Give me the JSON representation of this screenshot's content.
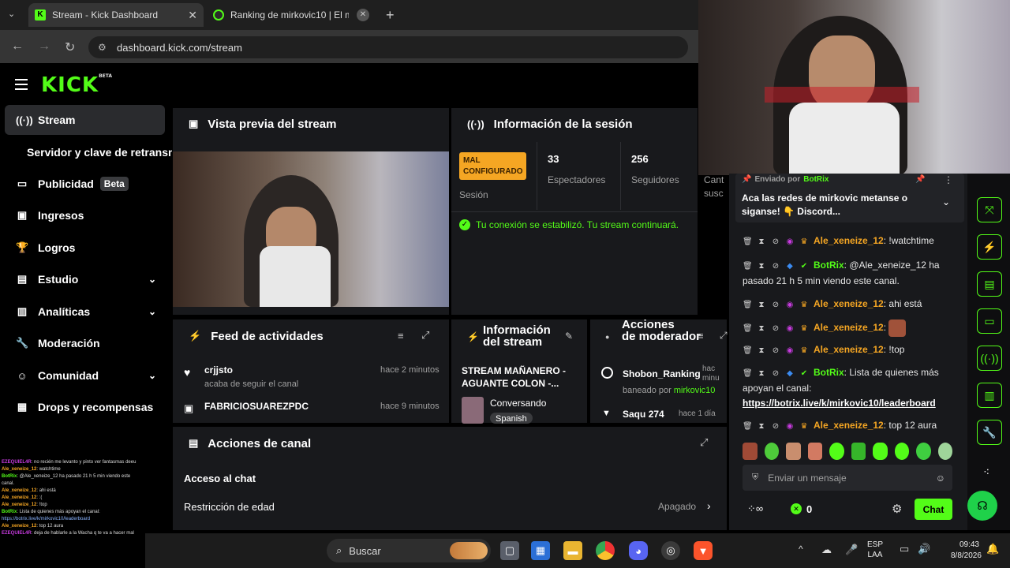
{
  "browser": {
    "tabs": [
      {
        "label": "Stream - Kick Dashboard",
        "close": "✕"
      },
      {
        "label": "Ranking de mirkovic10 | El mej",
        "close": "✕"
      }
    ],
    "new_tab": "+",
    "url": "dashboard.kick.com/stream"
  },
  "brand": {
    "logo": "KICK",
    "beta": "BETA",
    "accent": "#53fc18"
  },
  "sidebar": {
    "items": [
      {
        "label": "Stream",
        "icon": "broadcast-icon"
      },
      {
        "label": "Servidor y clave de retransn"
      },
      {
        "label": "Publicidad",
        "badge": "Beta",
        "icon": "ad-icon"
      },
      {
        "label": "Ingresos",
        "icon": "wallet-icon"
      },
      {
        "label": "Logros",
        "icon": "trophy-icon"
      },
      {
        "label": "Estudio",
        "icon": "studio-icon"
      },
      {
        "label": "Analíticas",
        "icon": "chart-icon"
      },
      {
        "label": "Moderación",
        "icon": "wrench-icon"
      },
      {
        "label": "Comunidad",
        "icon": "community-icon"
      },
      {
        "label": "Drops y recompensas",
        "icon": "gift-icon"
      }
    ]
  },
  "preview": {
    "title": "Vista previa del stream"
  },
  "session": {
    "title": "Información de la sesión",
    "status_badge": "MAL CONFIGURADO",
    "status_label": "Sesión",
    "viewers": "33",
    "viewers_label": "Espectadores",
    "followers": "256",
    "followers_label": "Seguidores",
    "extra_label": "Cant",
    "extra_label2": "susc",
    "connection": "Tu conexión se estabilizó. Tu stream continuará."
  },
  "feed": {
    "title": "Feed de actividades",
    "items": [
      {
        "user": "crjjsto",
        "action": "acaba de seguir el canal",
        "time": "hace 2 minutos"
      },
      {
        "user": "FABRICIOSUAREZPDC",
        "action": "",
        "time": "hace 9 minutos"
      }
    ]
  },
  "stream_info": {
    "title1": "Información",
    "title2": "del stream",
    "stream_title": "STREAM MAÑANERO - AGUANTE COLON -...",
    "category": "Conversando",
    "language": "Spanish"
  },
  "mod_actions": {
    "title1": "Acciones",
    "title2": "de moderador",
    "items": [
      {
        "user": "Shobon_Ranking",
        "detail": "baneado por",
        "by": "mirkovic10",
        "time": "hac minu"
      },
      {
        "user": "Saqu",
        "count": "274",
        "time": "hace 1 día"
      }
    ]
  },
  "channel_actions": {
    "title": "Acciones de canal",
    "chat_access": "Acceso al chat",
    "age_restriction": "Restricción de edad",
    "age_value": "Apagado"
  },
  "pinned": {
    "sent_by": "Enviado por",
    "bot": "BotRix",
    "text": "Aca las redes de mirkovic metanse o siganse! 👇 Discord..."
  },
  "chat": {
    "messages": [
      {
        "user": "Ale_xeneize_12",
        "text": "!watchtime",
        "kind": "user"
      },
      {
        "user": "BotRix",
        "text": "@Ale_xeneize_12 ha pasado 21 h 5 min viendo este canal.",
        "kind": "bot"
      },
      {
        "user": "Ale_xeneize_12",
        "text": "ahi está",
        "kind": "user"
      },
      {
        "user": "Ale_xeneize_12",
        "text": "",
        "kind": "emote"
      },
      {
        "user": "Ale_xeneize_12",
        "text": "!top",
        "kind": "user"
      },
      {
        "user": "BotRix",
        "text": "Lista de quienes más apoyan el canal:",
        "kind": "bot"
      },
      {
        "user": "Ale_xeneize_12",
        "text": "top 12 aura",
        "kind": "user"
      }
    ],
    "link": "https://botrix.live/k/mirkovic10/leaderboard",
    "placeholder": "Enviar un mensaje",
    "points": "0",
    "send_label": "Chat"
  },
  "overlay_chat": [
    {
      "user": "EZEQUIEL4R",
      "text": "no recién me levanto y pinto ver fantasmas deeu"
    },
    {
      "user": "Ale_xeneize_12",
      "text": "watchtime"
    },
    {
      "user": "BotRix",
      "text": "@Ale_xeneize_12 ha pasado 21 h 5 min viendo este canal."
    },
    {
      "user": "Ale_xeneize_12",
      "text": "ahi está"
    },
    {
      "user": "Ale_xeneize_12",
      "text": ":("
    },
    {
      "user": "Ale_xeneize_12",
      "text": "!top"
    },
    {
      "user": "BotRix",
      "text": "Lista de quienes más apoyan el canal:"
    },
    {
      "user": "",
      "text": "https://botrix.live/k/mirkovic10/leaderboard"
    },
    {
      "user": "Ale_xeneize_12",
      "text": "top 12 aura"
    },
    {
      "user": "EZEQUIEL4R",
      "text": "deja de hablarle a la Wacha q te va a hacer mal"
    }
  ],
  "taskbar": {
    "search": "Buscar",
    "lang1": "ESP",
    "lang2": "LAA",
    "time": "09:43",
    "date": "8/8/2026"
  }
}
